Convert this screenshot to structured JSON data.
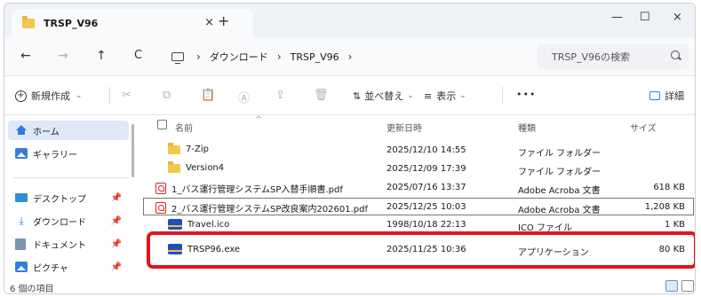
{
  "window": {
    "tab_title": "TRSP_V96",
    "tab_close": "×",
    "new_tab": "+",
    "minimize": "—",
    "maximize": "☐",
    "close": "×"
  },
  "navigation": {
    "back": "←",
    "forward": "→",
    "up": "↑",
    "refresh": "C",
    "breadcrumbs": [
      "ダウンロード",
      "TRSP_V96"
    ],
    "separator": "›",
    "search_placeholder": "TRSP_V96の検索"
  },
  "toolbar": {
    "new_label": "新規作成",
    "sort_label": "並べ替え",
    "view_label": "表示",
    "more_label": "•••",
    "details_label": "詳細"
  },
  "sidebar": {
    "items": [
      {
        "label": "ホーム",
        "icon": "home-icon",
        "active": true
      },
      {
        "label": "ギャラリー",
        "icon": "gallery-icon"
      },
      {
        "label": "デスクトップ",
        "icon": "desktop-icon",
        "pinned": true
      },
      {
        "label": "ダウンロード",
        "icon": "download-icon",
        "pinned": true
      },
      {
        "label": "ドキュメント",
        "icon": "documents-icon",
        "pinned": true
      },
      {
        "label": "ピクチャ",
        "icon": "pictures-icon",
        "pinned": true
      }
    ],
    "pin_glyph": "📌"
  },
  "columns": {
    "name": "名前",
    "modified": "更新日時",
    "type": "種類",
    "size": "サイズ"
  },
  "files": [
    {
      "name": "7-Zip",
      "modified": "2025/12/10 14:55",
      "type": "ファイル フォルダー",
      "size": "",
      "icon": "folder-icon"
    },
    {
      "name": "Version4",
      "modified": "2025/12/09 17:39",
      "type": "ファイル フォルダー",
      "size": "",
      "icon": "folder-icon"
    },
    {
      "name": "1_バス運行管理システムSP入替手順書.pdf",
      "modified": "2025/07/16 13:37",
      "type": "Adobe Acroba 文書",
      "size": "618 KB",
      "icon": "pdf-icon"
    },
    {
      "name": "2_バス運行管理システムSP改良案内202601.pdf",
      "modified": "2025/12/25 10:03",
      "type": "Adobe Acroba 文書",
      "size": "1,208 KB",
      "icon": "pdf-icon"
    },
    {
      "name": "Travel.ico",
      "modified": "1998/10/18 22:13",
      "type": "ICO ファイル",
      "size": "1 KB",
      "icon": "app-icon"
    },
    {
      "name": "TRSP96.exe",
      "modified": "2025/11/25 10:36",
      "type": "アプリケーション",
      "size": "80 KB",
      "icon": "app-icon"
    }
  ],
  "status": {
    "item_count": "6 個の項目"
  },
  "colors": {
    "highlight": "#e3141c",
    "accent": "#2f7de0"
  }
}
